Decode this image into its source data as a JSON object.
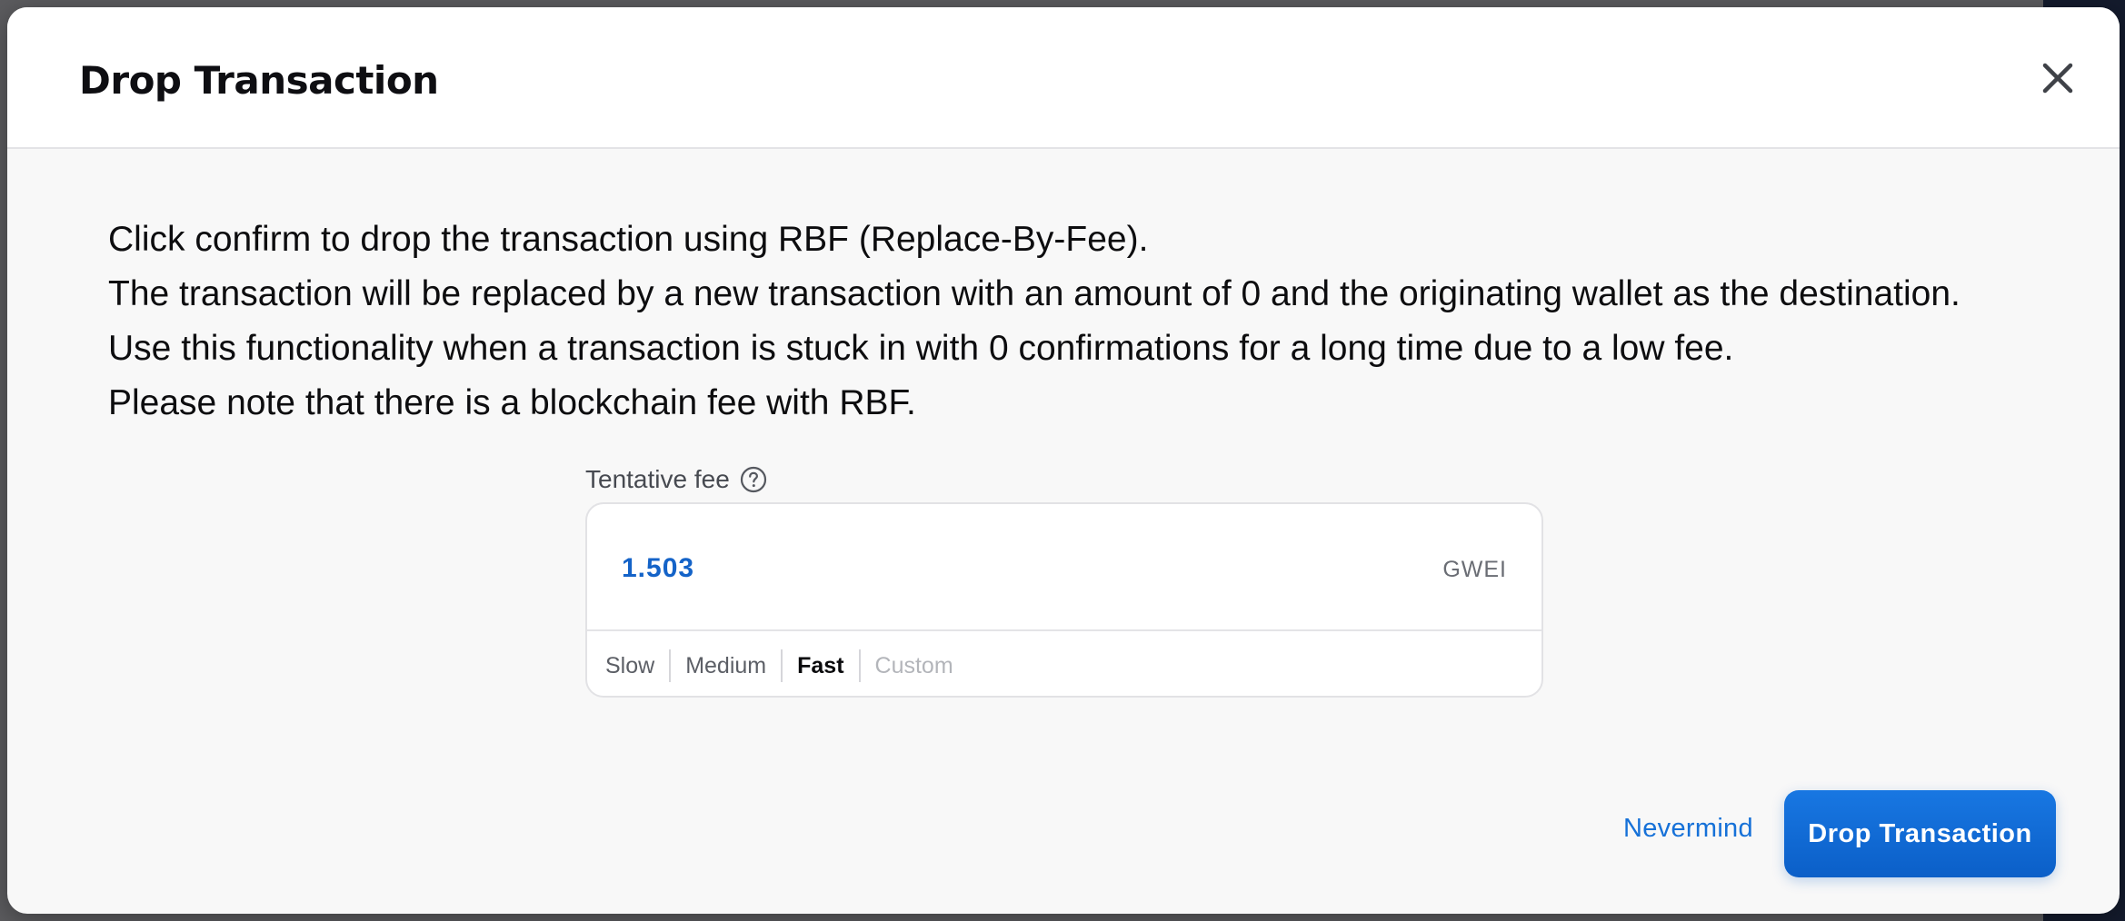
{
  "modal": {
    "title": "Drop Transaction",
    "close_icon": "close-icon"
  },
  "description": {
    "lines": [
      "Click confirm to drop the transaction using RBF (Replace-By-Fee).",
      "The transaction will be replaced by a new transaction with an amount of 0 and the originating wallet as the destination.",
      "Use this functionality when a transaction is stuck in with 0 confirmations for a long time due to a low fee.",
      "Please note that there is a blockchain fee with RBF."
    ]
  },
  "fee": {
    "label": "Tentative fee",
    "help_icon": "question-circle-icon",
    "value": "1.503",
    "unit": "GWEI",
    "speed_options": [
      "Slow",
      "Medium",
      "Fast",
      "Custom"
    ],
    "selected_speed": "Fast",
    "disabled_speed": "Custom"
  },
  "actions": {
    "secondary_label": "Nevermind",
    "primary_label": "Drop Transaction"
  },
  "colors": {
    "accent": "#1671d8",
    "primary_button": "#0b5fc8",
    "fee_value": "#1463c8"
  }
}
